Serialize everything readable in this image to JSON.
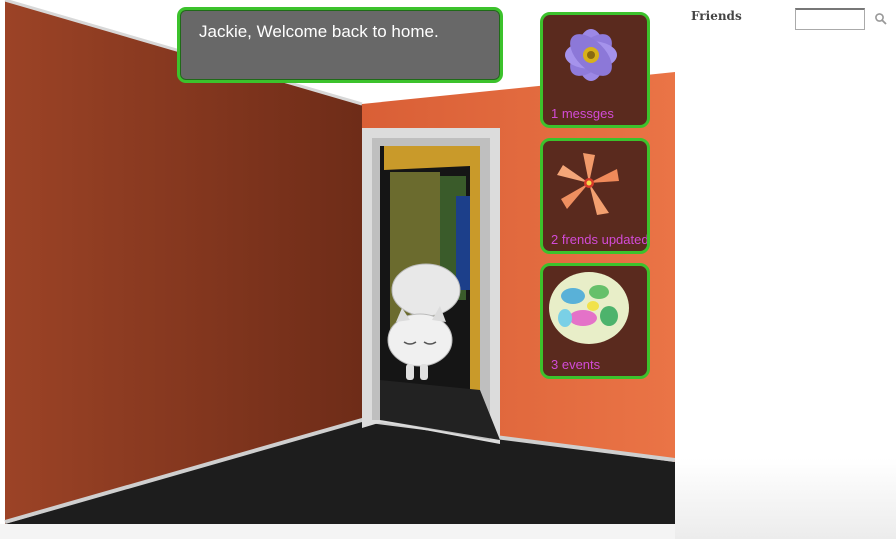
{
  "greeting": {
    "text": "Jackie, Welcome back to home."
  },
  "tiles": [
    {
      "label": "1 messges",
      "icon": "purple-flower-icon"
    },
    {
      "label": "2 frends updated",
      "icon": "orange-flower-icon"
    },
    {
      "label": "3 events",
      "icon": "painted-egg-icon"
    }
  ],
  "sidebar": {
    "title": "Friends",
    "search_value": "",
    "search_icon": "magnifier-icon"
  },
  "colors": {
    "tile_border": "#3cc22c",
    "tile_label": "#d24bd6",
    "left_wall": "#8f3c20",
    "right_wall": "#e06a3f",
    "floor": "#1d1d1d"
  }
}
